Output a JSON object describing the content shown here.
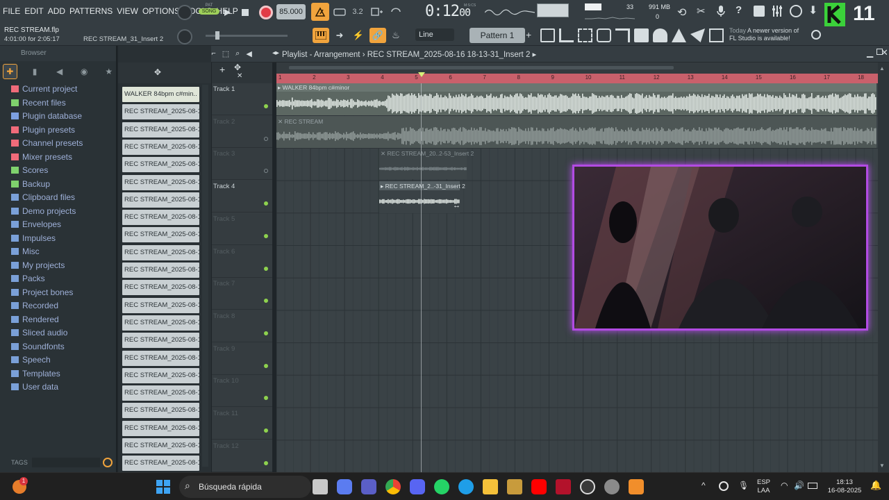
{
  "menu": [
    "FILE",
    "EDIT",
    "ADD",
    "PATTERNS",
    "VIEW",
    "OPTIONS",
    "TOOLS",
    "HELP"
  ],
  "transport": {
    "song_label": "SONG",
    "pat_label": "PAT",
    "tempo": "85.000",
    "time": "0:12",
    "time_small": "00",
    "time_unit": "M:S:CS",
    "cpu_value": "33",
    "ram_value": "991 MB",
    "ram_sub": "0",
    "big_number": "11"
  },
  "project": {
    "file": "REC STREAM.flp",
    "position": "4:01:00 for 2:05:17",
    "hint": "REC STREAM_31_Insert 2"
  },
  "toolbar2": {
    "snap": "Line",
    "pattern": "Pattern 1"
  },
  "news": {
    "label": "Today",
    "text_line1": "A newer version of",
    "text_line2": "FL Studio is available!"
  },
  "browser": {
    "title": "Browser",
    "items": [
      {
        "label": "Current project",
        "icon": "project-icon",
        "color": "#f06b7a"
      },
      {
        "label": "Recent files",
        "icon": "recent-icon",
        "color": "#7fd16d"
      },
      {
        "label": "Plugin database",
        "icon": "plugin-icon",
        "color": "#7da0e0"
      },
      {
        "label": "Plugin presets",
        "icon": "plugin-preset-icon",
        "color": "#f06b7a"
      },
      {
        "label": "Channel presets",
        "icon": "channel-preset-icon",
        "color": "#f06b7a"
      },
      {
        "label": "Mixer presets",
        "icon": "mixer-preset-icon",
        "color": "#f06b7a"
      },
      {
        "label": "Scores",
        "icon": "scores-icon",
        "color": "#7fd16d"
      },
      {
        "label": "Backup",
        "icon": "backup-icon",
        "color": "#7fd16d"
      },
      {
        "label": "Clipboard files",
        "icon": "folder-icon",
        "color": "#7aa0d8"
      },
      {
        "label": "Demo projects",
        "icon": "folder-icon",
        "color": "#7aa0d8"
      },
      {
        "label": "Envelopes",
        "icon": "folder-icon",
        "color": "#7aa0d8"
      },
      {
        "label": "Impulses",
        "icon": "folder-icon",
        "color": "#7aa0d8"
      },
      {
        "label": "Misc",
        "icon": "folder-icon",
        "color": "#7aa0d8"
      },
      {
        "label": "My projects",
        "icon": "folder-icon",
        "color": "#7aa0d8"
      },
      {
        "label": "Packs",
        "icon": "packs-icon",
        "color": "#7aa0d8"
      },
      {
        "label": "Project bones",
        "icon": "folder-icon",
        "color": "#7aa0d8"
      },
      {
        "label": "Recorded",
        "icon": "folder-icon",
        "color": "#7aa0d8"
      },
      {
        "label": "Rendered",
        "icon": "folder-icon",
        "color": "#7aa0d8"
      },
      {
        "label": "Sliced audio",
        "icon": "folder-icon",
        "color": "#7aa0d8"
      },
      {
        "label": "Soundfonts",
        "icon": "folder-icon",
        "color": "#7aa0d8"
      },
      {
        "label": "Speech",
        "icon": "folder-icon",
        "color": "#7aa0d8"
      },
      {
        "label": "Templates",
        "icon": "folder-icon",
        "color": "#7aa0d8"
      },
      {
        "label": "User data",
        "icon": "user-icon",
        "color": "#7aa0d8"
      }
    ],
    "tags_label": "TAGS"
  },
  "picker": [
    "WALKER 84bpm c#min..",
    "REC STREAM_2025-08-16..",
    "REC STREAM_2025-08-16..",
    "REC STREAM_2025-08-16..",
    "REC STREAM_2025-08-16..",
    "REC STREAM_2025-08-16..",
    "REC STREAM_2025-08-16..",
    "REC STREAM_2025-08-16..",
    "REC STREAM_2025-08-16..",
    "REC STREAM_2025-08-16..",
    "REC STREAM_2025-08-16..",
    "REC STREAM_2025-08-16..",
    "REC STREAM_2025-08-16..",
    "REC STREAM_2025-08-16..",
    "REC STREAM_2025-08-16..",
    "REC STREAM_2025-08-16..",
    "REC STREAM_2025-08-16..",
    "REC STREAM_2025-08-16..",
    "REC STREAM_2025-08-16..",
    "REC STREAM_2025-08-16..",
    "REC STREAM_2025-08-16..",
    "REC STREAM_2025-08-16.."
  ],
  "playlist": {
    "title": "Playlist - Arrangement",
    "separator": "›",
    "pattern": "REC STREAM_2025-08-16 18-13-31_Insert 2",
    "bars": [
      "1",
      "2",
      "3",
      "4",
      "5",
      "6",
      "7",
      "8",
      "9",
      "10",
      "11",
      "12",
      "13",
      "14",
      "15",
      "16",
      "17",
      "18"
    ],
    "tracks": [
      "Track 1",
      "Track 2",
      "Track 3",
      "Track 4",
      "Track 5",
      "Track 6",
      "Track 7",
      "Track 8",
      "Track 9",
      "Track 10",
      "Track 11",
      "Track 12"
    ],
    "clips": [
      {
        "title": "WALKER 84bpm c#minor"
      },
      {
        "title": "REC STREAM"
      },
      {
        "title": "REC STREAM_20..2-53_Insert 2"
      },
      {
        "title": "REC STREAM_2..-31_Insert 2"
      }
    ]
  },
  "taskbar": {
    "search": "Búsqueda rápida",
    "lang1": "ESP",
    "lang2": "LAA",
    "time": "18:13",
    "date": "16-08-2025",
    "badge": "1"
  }
}
